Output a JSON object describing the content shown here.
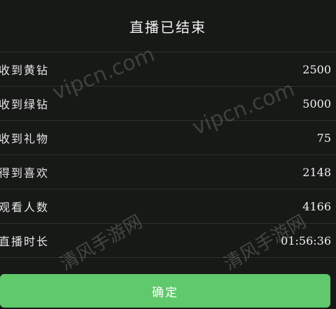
{
  "header": {
    "title": "直播已结束"
  },
  "stats": [
    {
      "label": "收到黄钻",
      "value": "2500"
    },
    {
      "label": "收到绿钻",
      "value": "5000"
    },
    {
      "label": "收到礼物",
      "value": "75"
    },
    {
      "label": "得到喜欢",
      "value": "2148"
    },
    {
      "label": "观看人数",
      "value": "4166"
    },
    {
      "label": "直播时长",
      "value": "01:56:36"
    }
  ],
  "confirm_button": {
    "label": "确定",
    "color": "#5fc96b"
  },
  "watermarks": {
    "url_1": "vipcn.com",
    "url_2": "vipcn.com",
    "brand_1": "清风手游网",
    "brand_2": "清风手游网"
  }
}
